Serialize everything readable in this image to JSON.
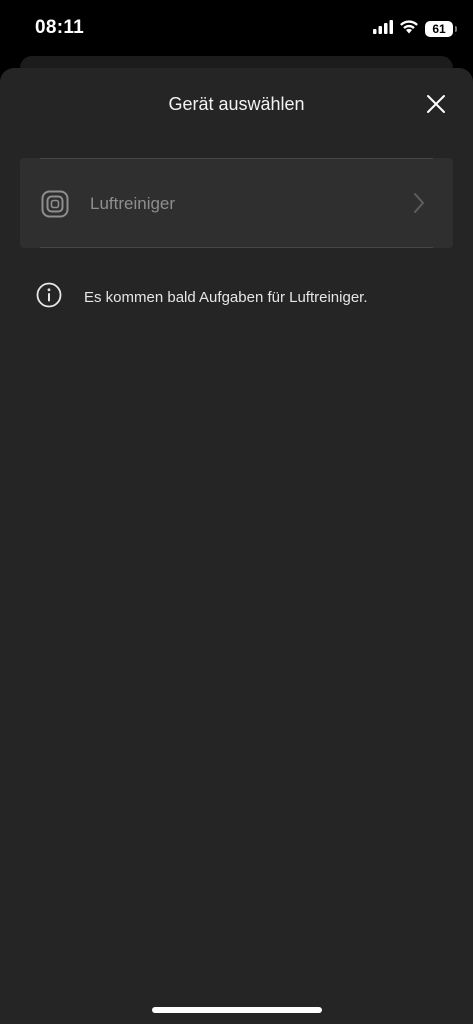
{
  "status_bar": {
    "time": "08:11",
    "battery": "61",
    "icons": [
      "signal-icon",
      "wifi-icon",
      "battery-icon"
    ]
  },
  "sheet": {
    "title": "Gerät auswählen",
    "close_icon": "close-icon"
  },
  "device_list": {
    "items": [
      {
        "label": "Luftreiniger",
        "icon": "air-purifier-icon",
        "trailing_icon": "chevron-right-icon"
      }
    ]
  },
  "info": {
    "icon": "info-icon",
    "text": "Es kommen bald Aufgaben für Luftreiniger."
  },
  "colors": {
    "background": "#000000",
    "sheet": "#252525",
    "list_item": "#2f2f2f",
    "muted_text": "#8e8e8e"
  }
}
